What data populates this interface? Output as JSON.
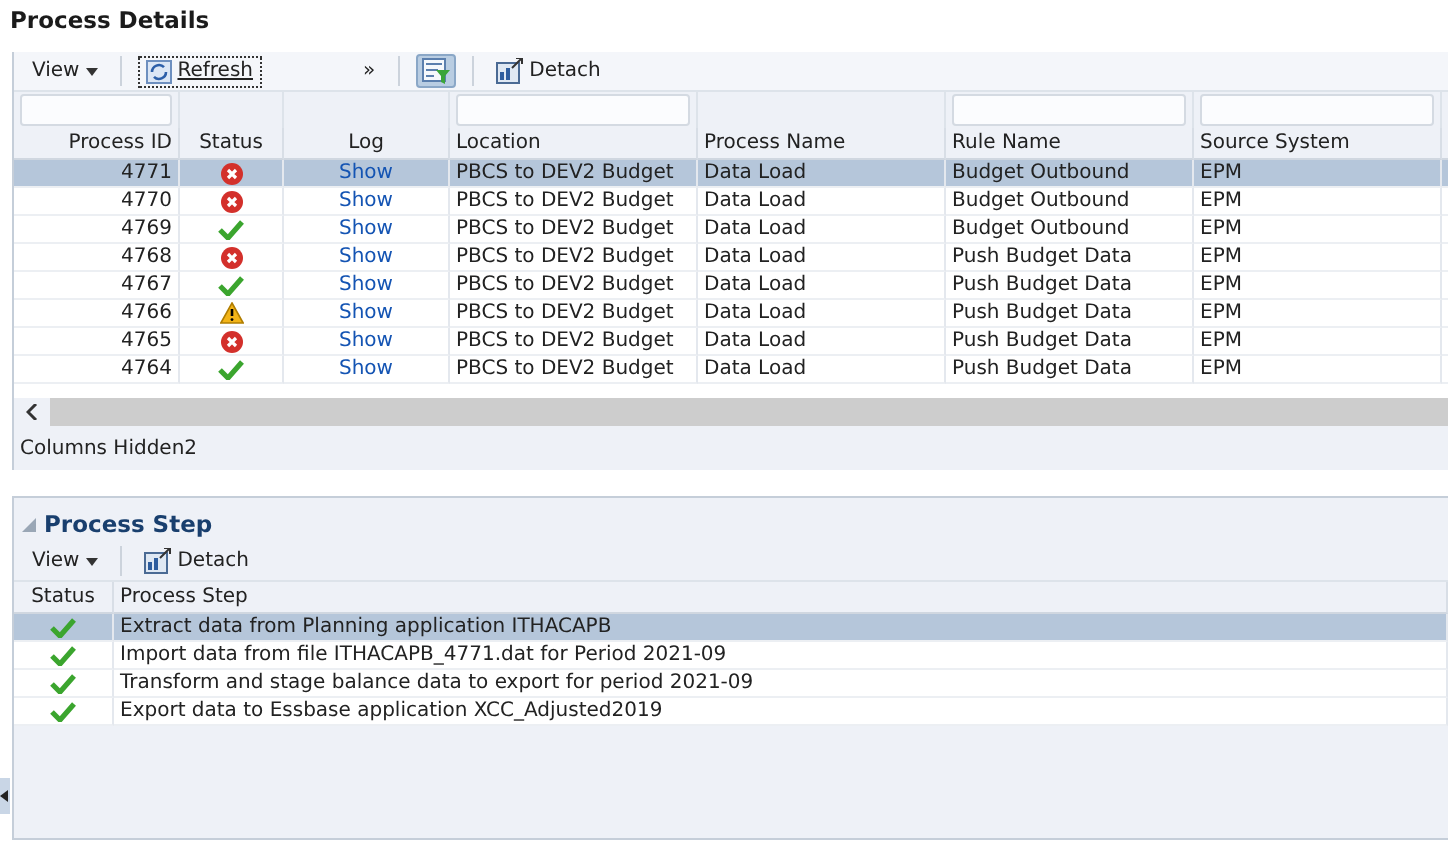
{
  "details": {
    "title": "Process Details",
    "toolbar": {
      "view": "View",
      "refresh": "Refresh",
      "overflow": "»",
      "filter_on": true,
      "detach": "Detach"
    },
    "columns": [
      "Process ID",
      "Status",
      "Log",
      "Location",
      "Process Name",
      "Rule Name",
      "Source System"
    ],
    "filters": [
      true,
      false,
      false,
      true,
      false,
      true,
      true
    ],
    "rows": [
      {
        "id": "4771",
        "kind": "error",
        "log": "Show",
        "location": "PBCS to DEV2 Budget",
        "process": "Data Load",
        "rule": "Budget Outbound",
        "source": "EPM",
        "selected": true
      },
      {
        "id": "4770",
        "kind": "error",
        "log": "Show",
        "location": "PBCS to DEV2 Budget",
        "process": "Data Load",
        "rule": "Budget Outbound",
        "source": "EPM",
        "selected": false
      },
      {
        "id": "4769",
        "kind": "success",
        "log": "Show",
        "location": "PBCS to DEV2 Budget",
        "process": "Data Load",
        "rule": "Budget Outbound",
        "source": "EPM",
        "selected": false
      },
      {
        "id": "4768",
        "kind": "error",
        "log": "Show",
        "location": "PBCS to DEV2 Budget",
        "process": "Data Load",
        "rule": "Push Budget Data",
        "source": "EPM",
        "selected": false
      },
      {
        "id": "4767",
        "kind": "success",
        "log": "Show",
        "location": "PBCS to DEV2 Budget",
        "process": "Data Load",
        "rule": "Push Budget Data",
        "source": "EPM",
        "selected": false
      },
      {
        "id": "4766",
        "kind": "warning",
        "log": "Show",
        "location": "PBCS to DEV2 Budget",
        "process": "Data Load",
        "rule": "Push Budget Data",
        "source": "EPM",
        "selected": false
      },
      {
        "id": "4765",
        "kind": "error",
        "log": "Show",
        "location": "PBCS to DEV2 Budget",
        "process": "Data Load",
        "rule": "Push Budget Data",
        "source": "EPM",
        "selected": false
      },
      {
        "id": "4764",
        "kind": "success",
        "log": "Show",
        "location": "PBCS to DEV2 Budget",
        "process": "Data Load",
        "rule": "Push Budget Data",
        "source": "EPM",
        "selected": false
      }
    ],
    "footer": "Columns Hidden2"
  },
  "steps": {
    "title": "Process Step",
    "toolbar": {
      "view": "View",
      "detach": "Detach"
    },
    "columns": [
      "Status",
      "Process Step"
    ],
    "rows": [
      {
        "kind": "success",
        "step": "Extract data from Planning application ITHACAPB",
        "selected": true
      },
      {
        "kind": "success",
        "step": "Import data from file ITHACAPB_4771.dat for Period 2021-09",
        "selected": false
      },
      {
        "kind": "success",
        "step": "Transform and stage balance data to export for period 2021-09",
        "selected": false
      },
      {
        "kind": "success",
        "step": "Export data to Essbase application XCC_Adjusted2019",
        "selected": false
      }
    ]
  }
}
